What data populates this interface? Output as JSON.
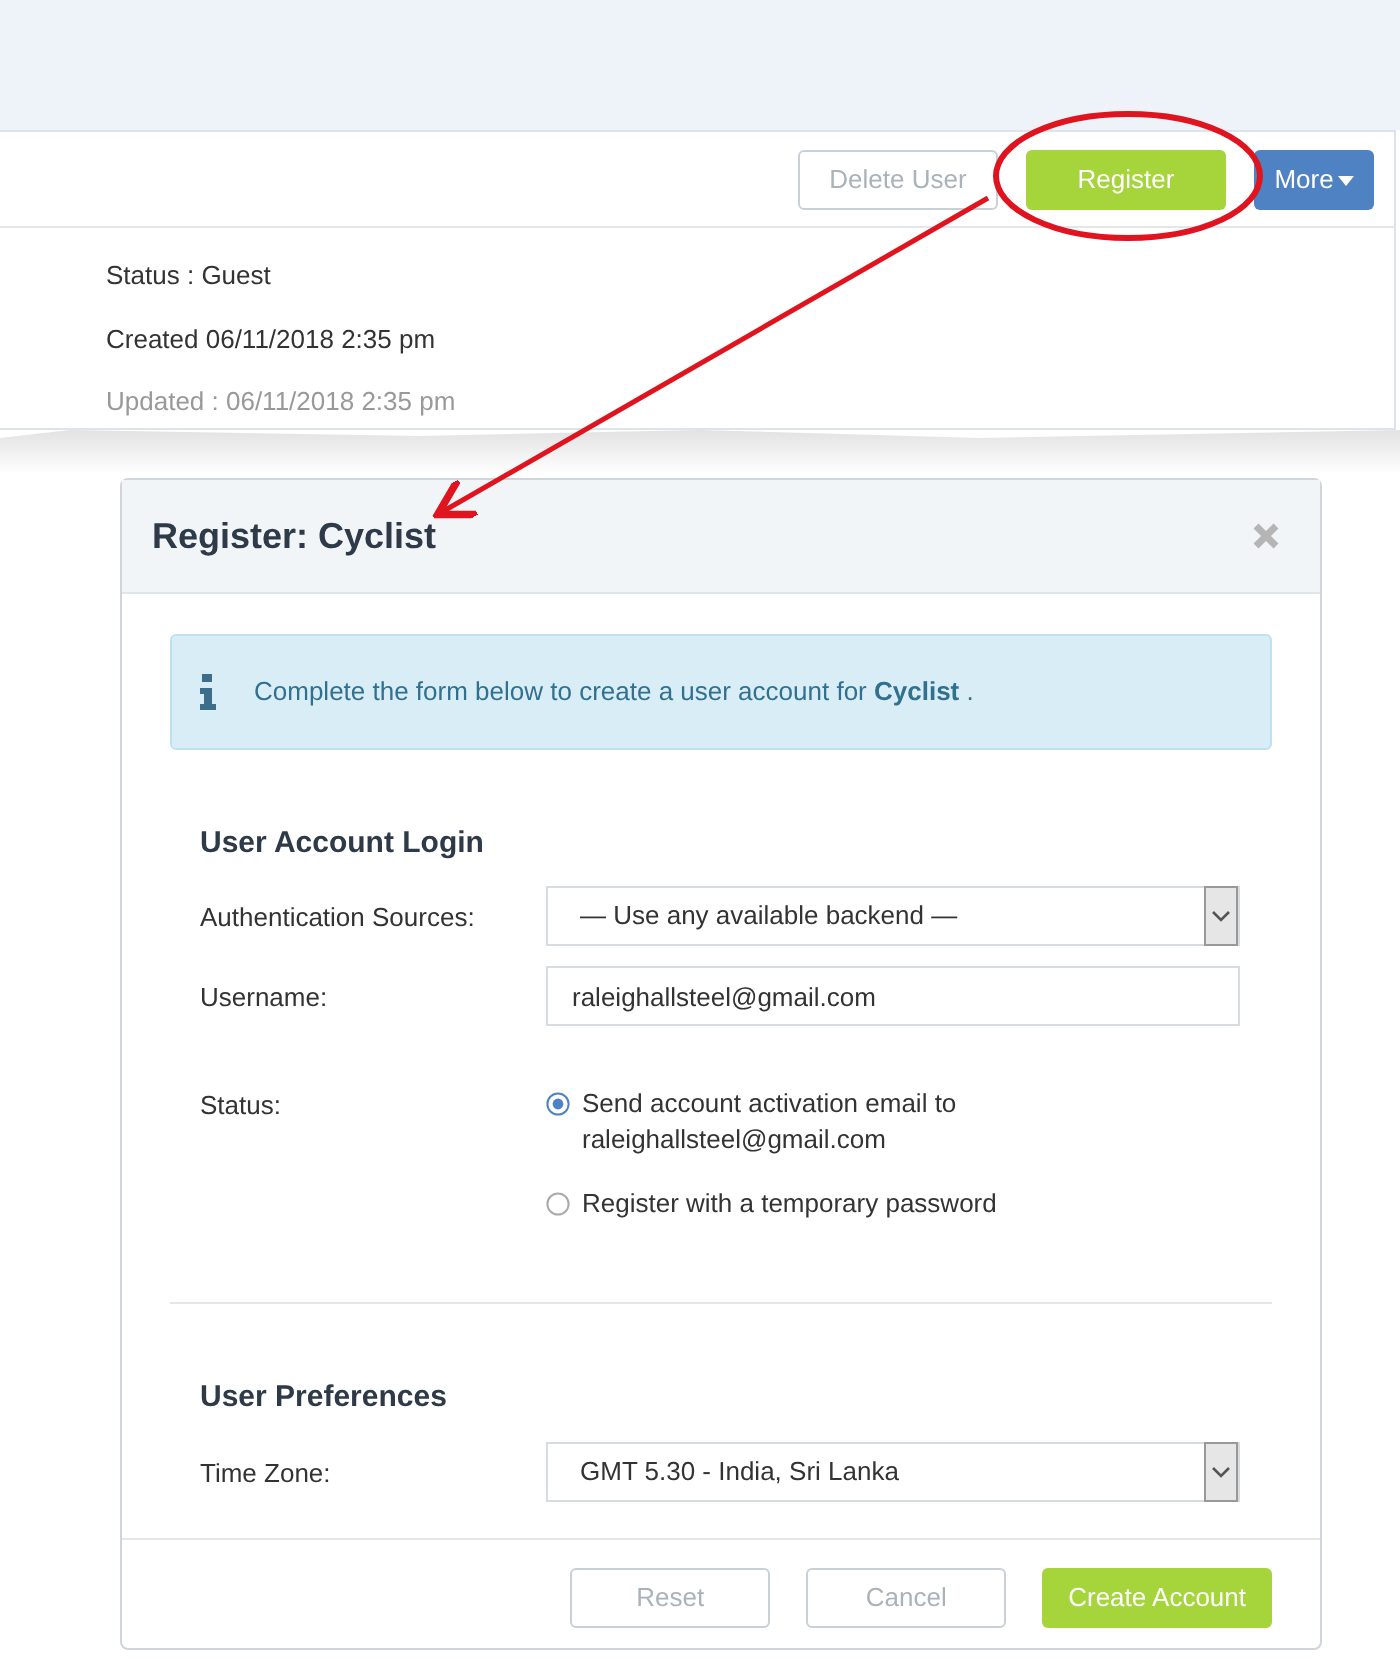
{
  "toolbar": {
    "buttons": [
      {
        "label": "Delete User",
        "kind": "outline",
        "disabled": true
      },
      {
        "label": "Register",
        "kind": "success",
        "disabled": false
      },
      {
        "label": "More",
        "kind": "primary",
        "disabled": false
      }
    ]
  },
  "user_details": [
    {
      "text": "Status : Guest",
      "muted": false
    },
    {
      "text": "Created 06/11/2018 2:35 pm",
      "muted": false
    },
    {
      "text": "Updated : 06/11/2018 2:35 pm",
      "muted": true
    }
  ],
  "dialog": {
    "title": "Register: Cyclist",
    "alert": "Complete the form below to create a user account for **Cyclist** .",
    "sections": [
      {
        "heading": "User Account Login",
        "fields": [
          {
            "kind": "select",
            "label": "Authentication Sources:",
            "value": "— Use any available backend —"
          },
          {
            "kind": "text",
            "label": "Username:",
            "value": "raleighallsteel@gmail.com"
          },
          {
            "kind": "radio",
            "label": "Status:",
            "options": [
              {
                "label": "Send account activation email to raleighallsteel@gmail.com",
                "selected": true
              },
              {
                "label": "Register with a temporary password",
                "selected": false
              }
            ]
          }
        ]
      },
      {
        "heading": "User Preferences",
        "fields": [
          {
            "kind": "select",
            "label": "Time Zone:",
            "value": "GMT 5.30 - India, Sri Lanka"
          }
        ]
      }
    ],
    "buttons": [
      {
        "label": "Reset",
        "kind": "outline",
        "disabled": true
      },
      {
        "label": "Cancel",
        "kind": "outline",
        "disabled": true
      },
      {
        "label": "Create Account",
        "kind": "success",
        "disabled": false
      }
    ]
  }
}
